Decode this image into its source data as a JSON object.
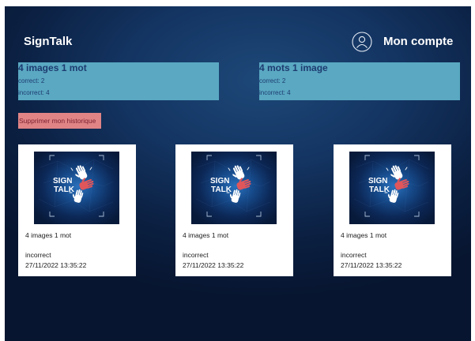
{
  "app": {
    "title": "SignTalk"
  },
  "header": {
    "account_label": "Mon compte",
    "account_icon": "user-circle-icon"
  },
  "stats": [
    {
      "title": "4 images 1 mot",
      "correct": "correct: 2",
      "incorrect": "incorrect: 4"
    },
    {
      "title": "4 mots 1 image",
      "correct": "correct: 2",
      "incorrect": "incorrect: 4"
    }
  ],
  "actions": {
    "clear_history_label": "Supprimer mon historique"
  },
  "logo": {
    "line1": "SIGN",
    "line2": "TALK",
    "icon": "signtalk-logo"
  },
  "history": [
    {
      "game": "4 images 1 mot",
      "result": "incorrect",
      "date": "27/11/2022 13:35:22"
    },
    {
      "game": "4 images 1 mot",
      "result": "incorrect",
      "date": "27/11/2022 13:35:22"
    },
    {
      "game": "4 images 1 mot",
      "result": "incorrect",
      "date": "27/11/2022 13:35:22"
    }
  ],
  "colors": {
    "background": "#0b2042",
    "stat_box": "#5aa8c2",
    "stat_text": "#1d3b70",
    "danger_button": "#e08486",
    "danger_text": "#7c2230",
    "card": "#ffffff",
    "logo_accent": "#e0565b"
  }
}
